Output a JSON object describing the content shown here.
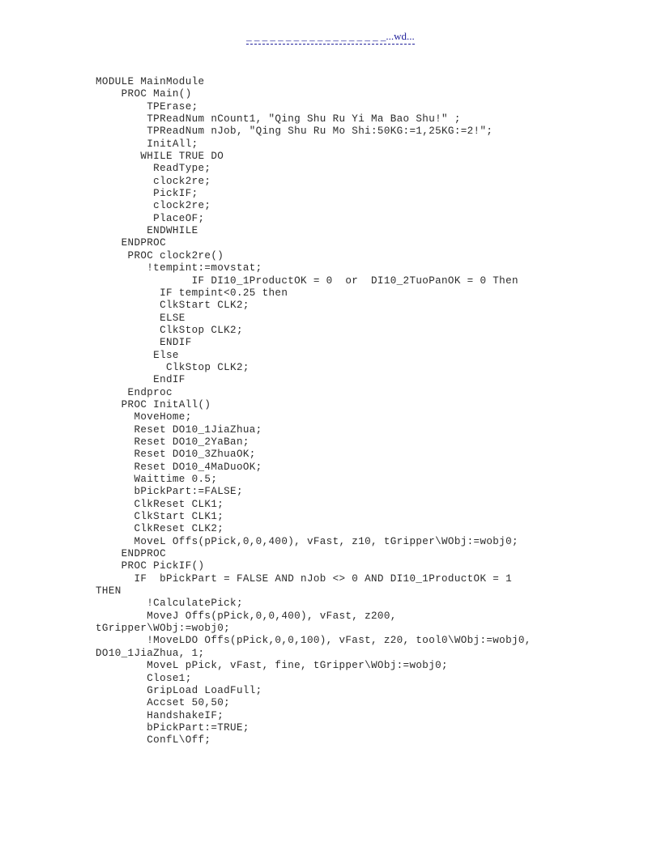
{
  "document": {
    "type": "code-listing",
    "language": "RAPID",
    "text_color": "#2b2b2b",
    "background_color": "#ffffff"
  },
  "header": {
    "link_color": "#22229c",
    "dashes": "_ _ _ _ _ _ _ _ _ _ _ _ _ _ _ _ _ _",
    "suffix": "...wd...",
    "full_text": "_ _ _ _ _ _ _ _ _ _ _ _ _ _ _ _ _ _...wd..."
  },
  "code": {
    "lines": [
      "MODULE MainModule",
      "    PROC Main()",
      "        TPErase;",
      "        TPReadNum nCount1, \"Qing Shu Ru Yi Ma Bao Shu!\" ;",
      "        TPReadNum nJob, \"Qing Shu Ru Mo Shi:50KG:=1,25KG:=2!\";",
      "        InitAll;",
      "       WHILE TRUE DO",
      "         ReadType;",
      "         clock2re;",
      "         PickIF;",
      "         clock2re;",
      "         PlaceOF;",
      "        ENDWHILE",
      "    ENDPROC",
      "     PROC clock2re()",
      "        !tempint:=movstat;",
      "               IF DI10_1ProductOK = 0  or  DI10_2TuoPanOK = 0 Then",
      "          IF tempint<0.25 then",
      "          ClkStart CLK2;",
      "          ELSE",
      "          ClkStop CLK2;",
      "          ENDIF",
      "         Else",
      "           ClkStop CLK2;",
      "         EndIF",
      "     Endproc",
      "    PROC InitAll()",
      "      MoveHome;",
      "      Reset DO10_1JiaZhua;",
      "      Reset DO10_2YaBan;",
      "      Reset DO10_3ZhuaOK;",
      "      Reset DO10_4MaDuoOK;",
      "      Waittime 0.5;",
      "      bPickPart:=FALSE;",
      "      ClkReset CLK1;",
      "      ClkStart CLK1;",
      "      ClkReset CLK2;",
      "      MoveL Offs(pPick,0,0,400), vFast, z10, tGripper\\WObj:=wobj0;",
      "    ENDPROC",
      "    PROC PickIF()",
      "      IF  bPickPart = FALSE AND nJob <> 0 AND DI10_1ProductOK = 1",
      "THEN",
      "        !CalculatePick;",
      "        MoveJ Offs(pPick,0,0,400), vFast, z200,",
      "tGripper\\WObj:=wobj0;",
      "        !MoveLDO Offs(pPick,0,0,100), vFast, z20, tool0\\WObj:=wobj0,",
      "DO10_1JiaZhua, 1;",
      "        MoveL pPick, vFast, fine, tGripper\\WObj:=wobj0;",
      "        Close1;",
      "        GripLoad LoadFull;",
      "        Accset 50,50;",
      "        HandshakeIF;",
      "        bPickPart:=TRUE;",
      "        ConfL\\Off;"
    ]
  }
}
